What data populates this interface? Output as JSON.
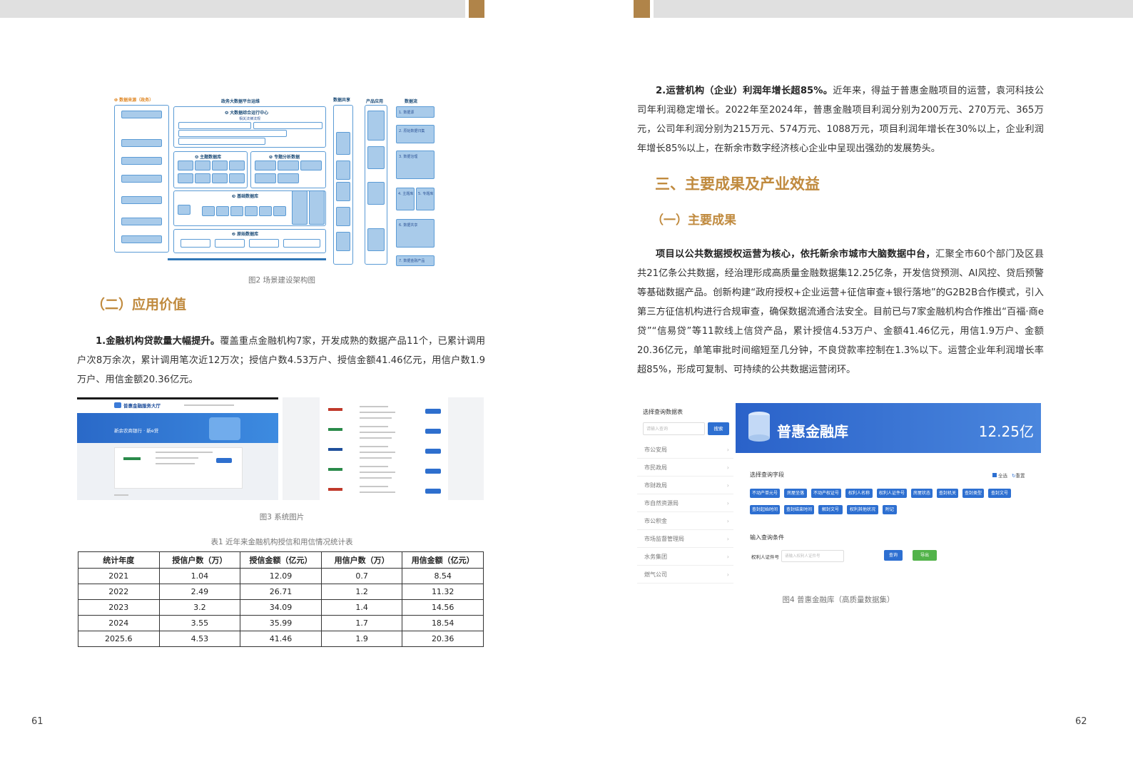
{
  "left_page": {
    "page_number": "61",
    "figure2": {
      "caption": "图2 场景建设架构图",
      "labels": {
        "data_source": "❶ 数据来源（政务）",
        "big_data": "政务大数据平台运维",
        "ops_center": "❹ 大数据综合运行中心",
        "law": "相关法律法规",
        "theme_db": "❹ 主题数据库",
        "special_db": "❺ 专题分析数据",
        "base_db": "❸ 基础数据库",
        "raw_db": "❷ 原始数据库",
        "share": "数据共享",
        "product": "产品应用",
        "flow": "数据流",
        "flow_steps": [
          "1. 数据源",
          "2. 原始数据归集",
          "3. 数据治理",
          "4. 主题库",
          "5. 专题库",
          "6. 数据共享",
          "7. 数据金融产品"
        ]
      }
    },
    "section_heading": "（二）应用价值",
    "para1_bold": "1.金融机构贷款量大幅提升。",
    "para1_text": "覆盖重点金融机构7家，开发成熟的数据产品11个，已累计调用户次8万余次，累计调用笔次近12万次；授信户数4.53万户、授信金额41.46亿元，用信户数1.9万户、用信金额20.36亿元。",
    "figure3": {
      "caption": "图3 系统图片",
      "screen_title": "普惠金融服务大厅",
      "banner_text": "新余农商银行 · 新e贷"
    },
    "table1": {
      "caption": "表1 近年来金融机构授信和用信情况统计表",
      "headers": [
        "统计年度",
        "授信户数（万）",
        "授信金额（亿元）",
        "用信户数（万）",
        "用信金额（亿元）"
      ],
      "rows": [
        [
          "2021",
          "1.04",
          "12.09",
          "0.7",
          "8.54"
        ],
        [
          "2022",
          "2.49",
          "26.71",
          "1.2",
          "11.32"
        ],
        [
          "2023",
          "3.2",
          "34.09",
          "1.4",
          "14.56"
        ],
        [
          "2024",
          "3.55",
          "35.99",
          "1.7",
          "18.54"
        ],
        [
          "2025.6",
          "4.53",
          "41.46",
          "1.9",
          "20.36"
        ]
      ]
    }
  },
  "right_page": {
    "page_number": "62",
    "para2_bold": "2.运营机构（企业）利润年增长超85%。",
    "para2_text": "近年来，得益于普惠金融项目的运营，袁河科技公司年利润稳定增长。2022年至2024年，普惠金融项目利润分别为200万元、270万元、365万元，公司年利润分别为215万元、574万元、1088万元，项目利润年增长在30%以上，企业利润年增长85%以上，在新余市数字经济核心企业中呈现出强劲的发展势头。",
    "section_heading": "三、主要成果及产业效益",
    "sub_heading": "（一）主要成果",
    "para3_bold": "项目以公共数据授权运营为核心，依托新余市城市大脑数据中台，",
    "para3_text": "汇聚全市60个部门及区县共21亿条公共数据，经治理形成高质量金融数据集12.25亿条，开发信贷预测、AI风控、贷后预警等基础数据产品。创新构建“政府授权+企业运营+征信审查+银行落地”的G2B2B合作模式，引入第三方征信机构进行合规审查，确保数据流通合法安全。目前已与7家金融机构合作推出“百福·商e贷”“信易贷”等11款线上信贷产品，累计授信4.53万户、金额41.46亿元，用信1.9万户、金额20.36亿元，单笔审批时间缩短至几分钟，不良贷款率控制在1.3%以下。运营企业年利润增长率超85%，形成可复制、可持续的公共数据运营闭环。",
    "figure4": {
      "caption": "图4 普惠金融库（高质量数据集）",
      "sidebar_title": "选择查询数据表",
      "search_placeholder": "请输入查询",
      "search_button": "搜索",
      "sidebar_items": [
        "市公安局",
        "市民政局",
        "市财政局",
        "市自然资源局",
        "市公积金",
        "市场监督管理局",
        "水务集团",
        "燃气公司"
      ],
      "banner_title": "普惠金融库",
      "banner_value": "12.25亿",
      "field_section": "选择查询字段",
      "select_all": "全选",
      "reset": "重置",
      "field_chips": [
        "不动产单元号",
        "房屋坐落",
        "不动产权证号",
        "权利人名称",
        "权利人证件号",
        "房屋状态",
        "查封机关",
        "查封类型",
        "查封文号",
        "查封起始时间",
        "查封结束时间",
        "解封文号",
        "权利其他状况",
        "附记"
      ],
      "condition_section": "输入查询条件",
      "condition_label": "权利人证件号",
      "condition_placeholder": "请输入权利人证件号",
      "query_button": "查询",
      "export_button": "导出"
    }
  },
  "colors": {
    "accent_gold": "#c08a3e",
    "topbar_gold": "#b08449",
    "brand_blue": "#2d6fd1"
  }
}
